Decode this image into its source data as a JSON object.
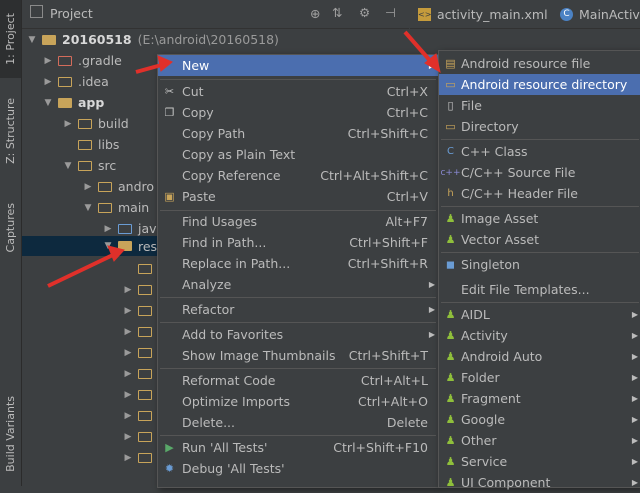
{
  "tool_strip": {
    "project": "1: Project",
    "structure": "Z: Structure",
    "captures": "Captures",
    "build_variants": "Build Variants"
  },
  "project_header": {
    "title": "Project",
    "icons": [
      "globe-icon",
      "collapse-icon",
      "gear-icon",
      "hide-icon"
    ]
  },
  "editor_tabs": [
    {
      "label": "activity_main.xml",
      "icon": "xml-file-icon"
    },
    {
      "label": "MainActivi",
      "icon": "class-icon"
    }
  ],
  "tree": {
    "root_name": "20160518",
    "root_path": "(E:\\android\\20160518)",
    "gradle": ".gradle",
    "idea": ".idea",
    "app": "app",
    "build": "build",
    "libs": "libs",
    "src": "src",
    "andro": "andro",
    "main": "main",
    "java": "java",
    "res": "res"
  },
  "context_menu": [
    {
      "label": "New",
      "selected": true,
      "submenu": true
    },
    {
      "sep": true
    },
    {
      "label": "Cut",
      "shortcut": "Ctrl+X",
      "icon": "scissors-icon"
    },
    {
      "label": "Copy",
      "shortcut": "Ctrl+C",
      "icon": "copy-icon"
    },
    {
      "label": "Copy Path",
      "shortcut": "Ctrl+Shift+C"
    },
    {
      "label": "Copy as Plain Text",
      "shortcut": ""
    },
    {
      "label": "Copy Reference",
      "shortcut": "Ctrl+Alt+Shift+C"
    },
    {
      "label": "Paste",
      "shortcut": "Ctrl+V",
      "icon": "paste-icon"
    },
    {
      "sep": true
    },
    {
      "label": "Find Usages",
      "shortcut": "Alt+F7"
    },
    {
      "label": "Find in Path...",
      "shortcut": "Ctrl+Shift+F"
    },
    {
      "label": "Replace in Path...",
      "shortcut": "Ctrl+Shift+R"
    },
    {
      "label": "Analyze",
      "submenu": true
    },
    {
      "sep": true
    },
    {
      "label": "Refactor",
      "submenu": true
    },
    {
      "sep": true
    },
    {
      "label": "Add to Favorites",
      "submenu": true
    },
    {
      "label": "Show Image Thumbnails",
      "shortcut": "Ctrl+Shift+T"
    },
    {
      "sep": true
    },
    {
      "label": "Reformat Code",
      "shortcut": "Ctrl+Alt+L"
    },
    {
      "label": "Optimize Imports",
      "shortcut": "Ctrl+Alt+O"
    },
    {
      "label": "Delete...",
      "shortcut": "Delete"
    },
    {
      "sep": true
    },
    {
      "label": "Run 'All Tests'",
      "shortcut": "Ctrl+Shift+F10",
      "icon": "run-icon"
    },
    {
      "label": "Debug 'All Tests'",
      "shortcut": "",
      "icon": "debug-icon"
    }
  ],
  "new_submenu": [
    {
      "label": "Android resource file",
      "icon": "android-resource-file-icon"
    },
    {
      "label": "Android resource directory",
      "selected": true,
      "icon": "folder-icon"
    },
    {
      "label": "File",
      "icon": "file-icon"
    },
    {
      "label": "Directory",
      "icon": "folder-icon"
    },
    {
      "sep": true
    },
    {
      "label": "C++ Class",
      "icon": "cpp-class-icon"
    },
    {
      "label": "C/C++ Source File",
      "icon": "cpp-source-icon"
    },
    {
      "label": "C/C++ Header File",
      "icon": "cpp-header-icon"
    },
    {
      "sep": true
    },
    {
      "label": "Image Asset",
      "icon": "android-icon"
    },
    {
      "label": "Vector Asset",
      "icon": "android-icon"
    },
    {
      "sep": true
    },
    {
      "label": "Singleton",
      "icon": "singleton-icon"
    },
    {
      "label": "Edit File Templates...",
      "icon": ""
    },
    {
      "sep": true
    },
    {
      "label": "AIDL",
      "icon": "android-icon",
      "submenu": true
    },
    {
      "label": "Activity",
      "icon": "android-icon",
      "submenu": true
    },
    {
      "label": "Android Auto",
      "icon": "android-icon",
      "submenu": true
    },
    {
      "label": "Folder",
      "icon": "android-icon",
      "submenu": true
    },
    {
      "label": "Fragment",
      "icon": "android-icon",
      "submenu": true
    },
    {
      "label": "Google",
      "icon": "android-icon",
      "submenu": true
    },
    {
      "label": "Other",
      "icon": "android-icon",
      "submenu": true
    },
    {
      "label": "Service",
      "icon": "android-icon",
      "submenu": true
    },
    {
      "label": "UI Component",
      "icon": "android-icon",
      "submenu": true
    }
  ],
  "colors": {
    "selection": "#4b6eaf",
    "background": "#3c3f41",
    "annotation_arrow": "#e0302a"
  }
}
